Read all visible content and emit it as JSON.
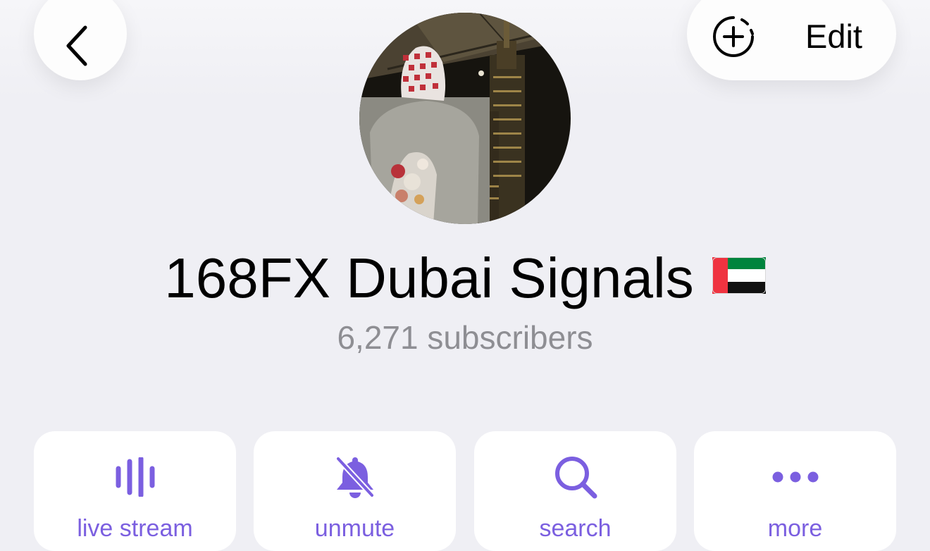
{
  "header": {
    "back_icon": "chevron-left-icon",
    "add_story_icon": "add-story-icon",
    "edit_label": "Edit"
  },
  "profile": {
    "name": "168FX Dubai Signals",
    "flag_emoji": "🇦🇪",
    "subscribers": "6,271 subscribers"
  },
  "actions": [
    {
      "label": "live stream",
      "icon": "live-stream-icon"
    },
    {
      "label": "unmute",
      "icon": "bell-slash-icon"
    },
    {
      "label": "search",
      "icon": "search-icon"
    },
    {
      "label": "more",
      "icon": "more-dots-icon"
    }
  ],
  "colors": {
    "background": "#efeff4",
    "accent": "#7b5fe0",
    "secondary_text": "#8e8e93",
    "flag_green": "#00843d",
    "flag_red": "#ef3340",
    "flag_black": "#000000"
  }
}
